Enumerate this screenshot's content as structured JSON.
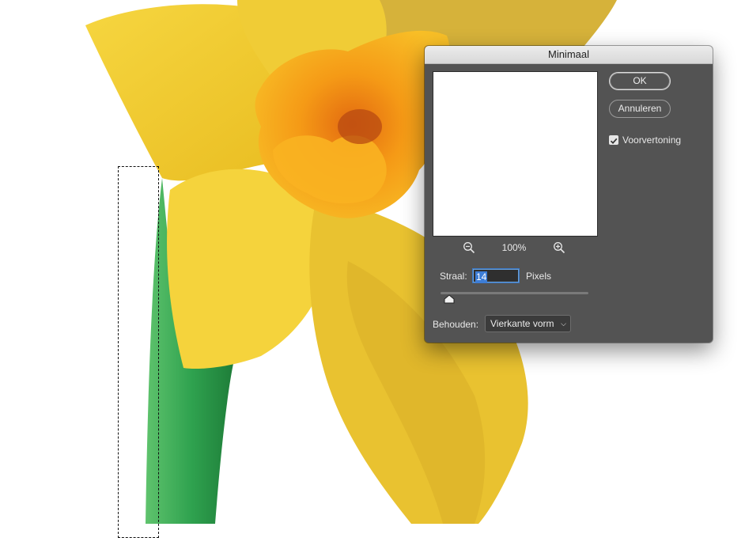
{
  "dialog": {
    "title": "Minimaal",
    "ok_label": "OK",
    "cancel_label": "Annuleren",
    "preview_label": "Voorvertoning",
    "preview_checked": true,
    "zoom_level": "100%",
    "zoom_out_icon": "zoom-out-icon",
    "zoom_in_icon": "zoom-in-icon",
    "radius_label": "Straal:",
    "radius_value": "14",
    "radius_unit": "Pixels",
    "preserve_label": "Behouden:",
    "preserve_value": "Vierkante vorm"
  },
  "canvas": {
    "subject": "yellow daffodil on white background with dashed selection marquee",
    "colors": {
      "petal": "#f2cc2a",
      "trumpet": "#f7a817",
      "stem": "#3aa957",
      "background": "#ffffff"
    }
  }
}
